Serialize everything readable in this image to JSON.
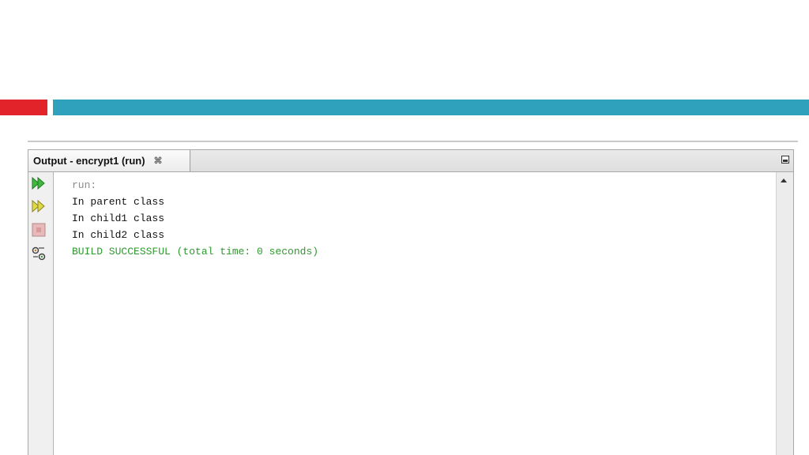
{
  "window": {
    "tab_title": "Output - encrypt1 (run)",
    "tab_close_glyph": "⌘"
  },
  "toolbar": {
    "tools": [
      {
        "name": "rerun-icon",
        "color": "#2e9a2e"
      },
      {
        "name": "rerun-with-options-icon",
        "color": "#c9c218"
      },
      {
        "name": "stop-icon",
        "color": "#c97f7f"
      },
      {
        "name": "settings-icon",
        "color": "#555555"
      }
    ]
  },
  "console": {
    "lines": [
      {
        "text": "run:",
        "style": "run"
      },
      {
        "text": "In parent class",
        "style": "out"
      },
      {
        "text": "In child1 class",
        "style": "out"
      },
      {
        "text": "In child2 class",
        "style": "out"
      },
      {
        "text": "BUILD SUCCESSFUL (total time: 0 seconds)",
        "style": "success"
      }
    ]
  },
  "colors": {
    "accent_red": "#e2232a",
    "accent_blue": "#2fa1bd",
    "success_green": "#2e9a2e"
  }
}
